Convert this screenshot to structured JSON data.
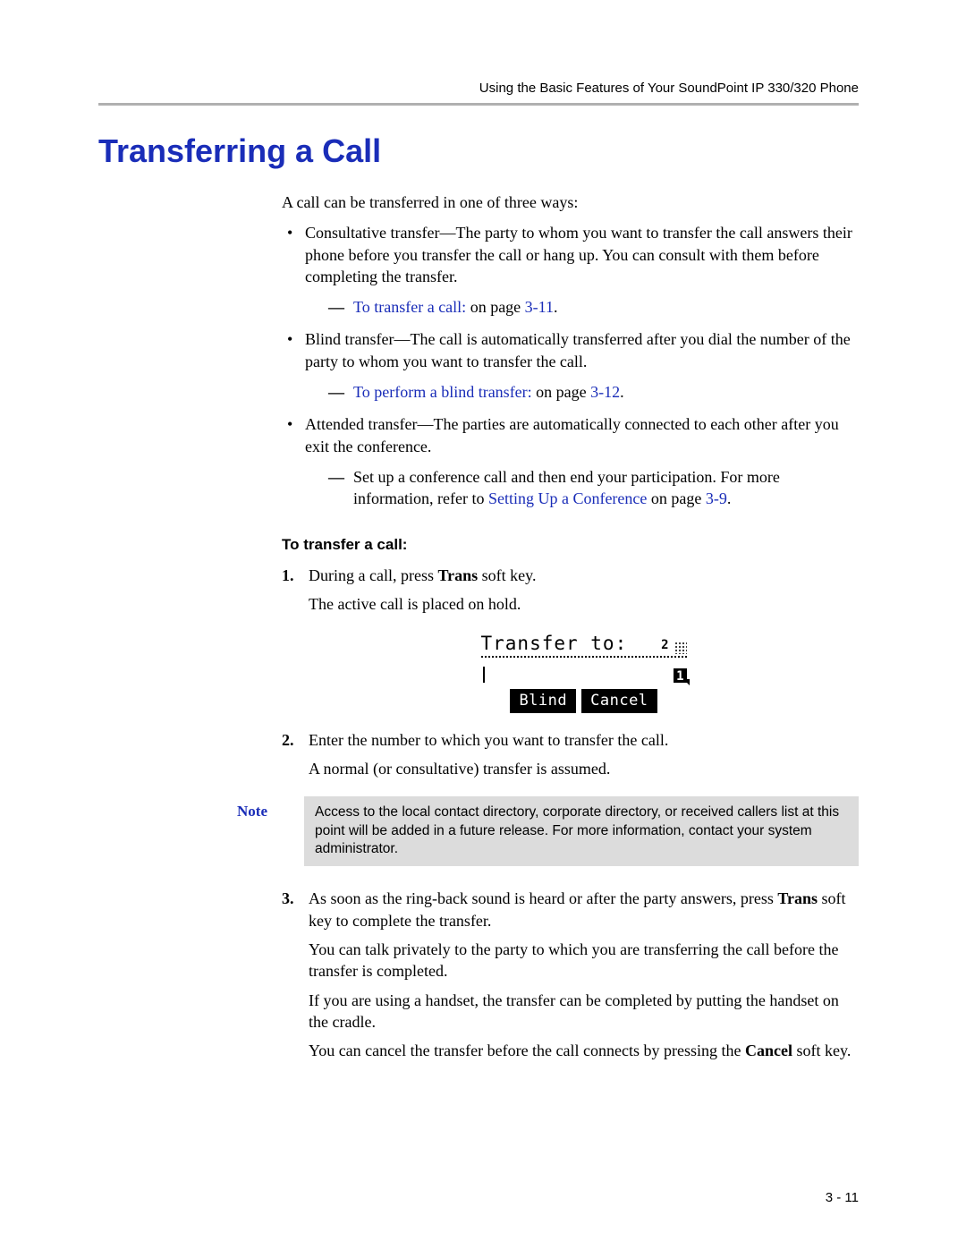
{
  "header": {
    "running_head": "Using the Basic Features of Your SoundPoint IP 330/320 Phone"
  },
  "title": "Transferring a Call",
  "intro": "A call can be transferred in one of three ways:",
  "bullets": {
    "consultative": {
      "text_a": "Consultative transfer—The party to whom you want to transfer the call answers their phone before you transfer the call or hang up. You can consult with them before completing the transfer.",
      "sub_link": "To transfer a call:",
      "sub_after": " on page ",
      "sub_page": "3-11",
      "sub_period": "."
    },
    "blind": {
      "text_a": "Blind transfer—The call is automatically transferred after you dial the number of the party to whom you want to transfer the call.",
      "sub_link": "To perform a blind transfer:",
      "sub_after": " on page ",
      "sub_page": "3-12",
      "sub_period": "."
    },
    "attended": {
      "text_a": "Attended transfer—The parties are automatically connected to each other after you exit the conference.",
      "sub_pre": "Set up a conference call and then end your participation. For more information, refer to ",
      "sub_link": "Setting Up a Conference",
      "sub_after": " on page ",
      "sub_page": "3-9",
      "sub_period": "."
    }
  },
  "procedure": {
    "heading": "To transfer a call:",
    "step1_a": "During a call, press ",
    "step1_b": "Trans",
    "step1_c": " soft key.",
    "step1_sub": "The active call is placed on hold.",
    "lcd": {
      "title": "Transfer to:",
      "indicator_num": "2",
      "badge": "1",
      "btn_blind": "Blind",
      "btn_cancel": "Cancel"
    },
    "step2_a": "Enter the number to which you want to transfer the call.",
    "step2_sub": "A normal (or consultative) transfer is assumed.",
    "note_label": "Note",
    "note_text": "Access to the local contact directory, corporate directory, or received callers list at this point will be added in a future release. For more information, contact your system administrator.",
    "step3_a": "As soon as the ring-back sound is heard or after the party answers, press ",
    "step3_b": "Trans",
    "step3_c": " soft key to complete the transfer.",
    "step3_p2": "You can talk privately to the party to which you are transferring the call before the transfer is completed.",
    "step3_p3": "If you are using a handset, the transfer can be completed by putting the handset on the cradle.",
    "step3_p4a": "You can cancel the transfer before the call connects by pressing the ",
    "step3_p4b": "Cancel",
    "step3_p4c": " soft key."
  },
  "footer": {
    "pageno": "3 - 11"
  }
}
